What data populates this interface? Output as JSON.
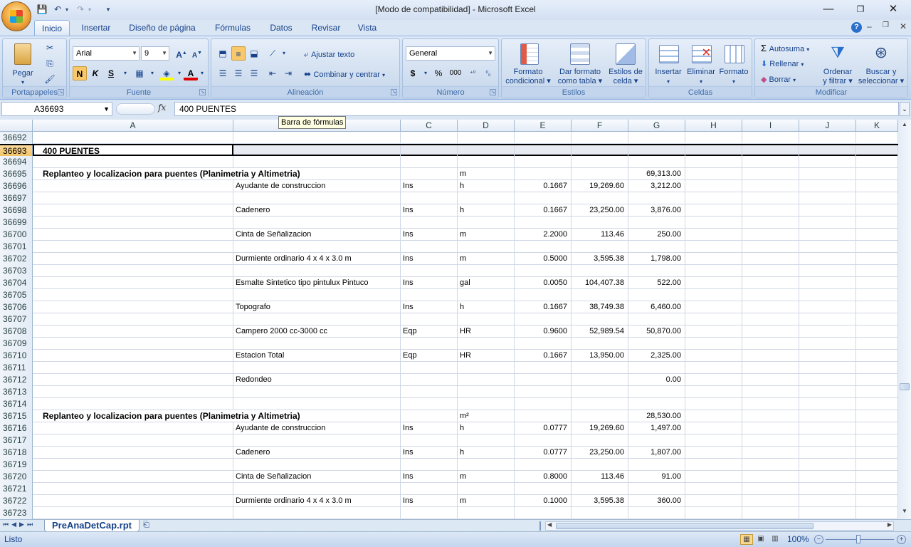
{
  "window": {
    "title": "[Modo de compatibilidad] - Microsoft Excel"
  },
  "qat": {
    "save_icon": "save-icon",
    "undo_icon": "undo-icon",
    "redo_icon": "redo-icon"
  },
  "tabs": [
    "Inicio",
    "Insertar",
    "Diseño de página",
    "Fórmulas",
    "Datos",
    "Revisar",
    "Vista"
  ],
  "ribbon": {
    "clipboard": {
      "paste": "Pegar",
      "label": "Portapapeles"
    },
    "font": {
      "family": "Arial",
      "size": "9",
      "bold": "N",
      "italic": "K",
      "underline": "S",
      "label": "Fuente"
    },
    "alignment": {
      "wrap": "Ajustar texto",
      "merge": "Combinar y centrar",
      "label": "Alineación"
    },
    "number": {
      "format": "General",
      "currency": "$",
      "percent": "%",
      "thousands": "000",
      "label": "Número"
    },
    "styles": {
      "conditional_1": "Formato",
      "conditional_2": "condicional",
      "table_1": "Dar formato",
      "table_2": "como tabla",
      "cell_1": "Estilos de",
      "cell_2": "celda",
      "label": "Estilos"
    },
    "cells": {
      "insert": "Insertar",
      "delete": "Eliminar",
      "format": "Formato",
      "label": "Celdas"
    },
    "editing": {
      "autosum": "Autosuma",
      "fill": "Rellenar",
      "clear": "Borrar",
      "sort_1": "Ordenar",
      "sort_2": "y filtrar",
      "find_1": "Buscar y",
      "find_2": "seleccionar",
      "label": "Modificar"
    }
  },
  "formula_bar": {
    "namebox": "A36693",
    "fx": "fx",
    "content": "400   PUENTES",
    "tooltip": "Barra de fórmulas"
  },
  "columns": [
    "A",
    "",
    "C",
    "D",
    "E",
    "F",
    "G",
    "H",
    "I",
    "J",
    "K"
  ],
  "rows": [
    {
      "n": "36692",
      "a": "",
      "b": "",
      "c": "",
      "d": "",
      "e": "",
      "f": "",
      "g": ""
    },
    {
      "n": "36693",
      "a": "400   PUENTES",
      "b": "",
      "c": "",
      "d": "",
      "e": "",
      "f": "",
      "g": ""
    },
    {
      "n": "36694",
      "a": "",
      "b": "",
      "c": "",
      "d": "",
      "e": "",
      "f": "",
      "g": ""
    },
    {
      "n": "36695",
      "a": "Replanteo y localizacion  para puentes (Planimetria y Altimetria)",
      "b": "",
      "c": "",
      "d": "m",
      "e": "",
      "f": "",
      "g": "69,313.00"
    },
    {
      "n": "36696",
      "a": "",
      "b": "Ayudante de construccion",
      "c": "Ins",
      "d": "h",
      "e": "0.1667",
      "f": "19,269.60",
      "g": "3,212.00"
    },
    {
      "n": "36697",
      "a": "",
      "b": "",
      "c": "",
      "d": "",
      "e": "",
      "f": "",
      "g": ""
    },
    {
      "n": "36698",
      "a": "",
      "b": "Cadenero",
      "c": "Ins",
      "d": "h",
      "e": "0.1667",
      "f": "23,250.00",
      "g": "3,876.00"
    },
    {
      "n": "36699",
      "a": "",
      "b": "",
      "c": "",
      "d": "",
      "e": "",
      "f": "",
      "g": ""
    },
    {
      "n": "36700",
      "a": "",
      "b": "Cinta de Señalizacion",
      "c": "Ins",
      "d": "m",
      "e": "2.2000",
      "f": "113.46",
      "g": "250.00"
    },
    {
      "n": "36701",
      "a": "",
      "b": "",
      "c": "",
      "d": "",
      "e": "",
      "f": "",
      "g": ""
    },
    {
      "n": "36702",
      "a": "",
      "b": "Durmiente ordinario 4 x 4 x 3.0 m",
      "c": "Ins",
      "d": "m",
      "e": "0.5000",
      "f": "3,595.38",
      "g": "1,798.00"
    },
    {
      "n": "36703",
      "a": "",
      "b": "",
      "c": "",
      "d": "",
      "e": "",
      "f": "",
      "g": ""
    },
    {
      "n": "36704",
      "a": "",
      "b": "Esmalte Sintetico tipo pintulux Pintuco",
      "c": "Ins",
      "d": "gal",
      "e": "0.0050",
      "f": "104,407.38",
      "g": "522.00"
    },
    {
      "n": "36705",
      "a": "",
      "b": "",
      "c": "",
      "d": "",
      "e": "",
      "f": "",
      "g": ""
    },
    {
      "n": "36706",
      "a": "",
      "b": "Topografo",
      "c": "Ins",
      "d": "h",
      "e": "0.1667",
      "f": "38,749.38",
      "g": "6,460.00"
    },
    {
      "n": "36707",
      "a": "",
      "b": "",
      "c": "",
      "d": "",
      "e": "",
      "f": "",
      "g": ""
    },
    {
      "n": "36708",
      "a": "",
      "b": "Campero 2000 cc-3000 cc",
      "c": "Eqp",
      "d": "HR",
      "e": "0.9600",
      "f": "52,989.54",
      "g": "50,870.00"
    },
    {
      "n": "36709",
      "a": "",
      "b": "",
      "c": "",
      "d": "",
      "e": "",
      "f": "",
      "g": ""
    },
    {
      "n": "36710",
      "a": "",
      "b": "Estacion Total",
      "c": "Eqp",
      "d": "HR",
      "e": "0.1667",
      "f": "13,950.00",
      "g": "2,325.00"
    },
    {
      "n": "36711",
      "a": "",
      "b": "",
      "c": "",
      "d": "",
      "e": "",
      "f": "",
      "g": ""
    },
    {
      "n": "36712",
      "a": "",
      "b": "Redondeo",
      "c": "",
      "d": "",
      "e": "",
      "f": "",
      "g": "0.00"
    },
    {
      "n": "36713",
      "a": "",
      "b": "",
      "c": "",
      "d": "",
      "e": "",
      "f": "",
      "g": ""
    },
    {
      "n": "36714",
      "a": "",
      "b": "",
      "c": "",
      "d": "",
      "e": "",
      "f": "",
      "g": ""
    },
    {
      "n": "36715",
      "a": "Replanteo y localizacion  para puentes (Planimetria y Altimetria)",
      "b": "",
      "c": "",
      "d": "m²",
      "e": "",
      "f": "",
      "g": "28,530.00"
    },
    {
      "n": "36716",
      "a": "",
      "b": "Ayudante de construccion",
      "c": "Ins",
      "d": "h",
      "e": "0.0777",
      "f": "19,269.60",
      "g": "1,497.00"
    },
    {
      "n": "36717",
      "a": "",
      "b": "",
      "c": "",
      "d": "",
      "e": "",
      "f": "",
      "g": ""
    },
    {
      "n": "36718",
      "a": "",
      "b": "Cadenero",
      "c": "Ins",
      "d": "h",
      "e": "0.0777",
      "f": "23,250.00",
      "g": "1,807.00"
    },
    {
      "n": "36719",
      "a": "",
      "b": "",
      "c": "",
      "d": "",
      "e": "",
      "f": "",
      "g": ""
    },
    {
      "n": "36720",
      "a": "",
      "b": "Cinta de Señalizacion",
      "c": "Ins",
      "d": "m",
      "e": "0.8000",
      "f": "113.46",
      "g": "91.00"
    },
    {
      "n": "36721",
      "a": "",
      "b": "",
      "c": "",
      "d": "",
      "e": "",
      "f": "",
      "g": ""
    },
    {
      "n": "36722",
      "a": "",
      "b": "Durmiente ordinario 4 x 4 x 3.0 m",
      "c": "Ins",
      "d": "m",
      "e": "0.1000",
      "f": "3,595.38",
      "g": "360.00"
    },
    {
      "n": "36723",
      "a": "",
      "b": "",
      "c": "",
      "d": "",
      "e": "",
      "f": "",
      "g": ""
    }
  ],
  "sheet_tab": "PreAnaDetCap.rpt",
  "status": {
    "mode": "Listo",
    "zoom": "100%"
  },
  "colors": {
    "accent": "#15428b",
    "selection_header": "#f1c15f"
  }
}
